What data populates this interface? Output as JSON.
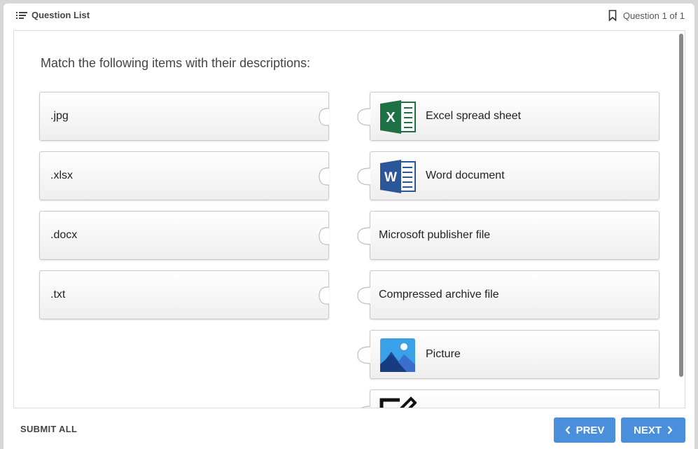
{
  "header": {
    "question_list_label": "Question List",
    "question_counter": "Question 1 of 1",
    "list_icon": "list-icon",
    "bookmark_icon": "bookmark-icon"
  },
  "question": {
    "text": "Match the following items with their descriptions:"
  },
  "left_items": [
    {
      "label": ".jpg"
    },
    {
      "label": ".xlsx"
    },
    {
      "label": ".docx"
    },
    {
      "label": ".txt"
    }
  ],
  "right_items": [
    {
      "label": "Excel spread sheet",
      "icon": "excel-icon"
    },
    {
      "label": "Word document",
      "icon": "word-icon"
    },
    {
      "label": "Microsoft publisher file",
      "icon": ""
    },
    {
      "label": "Compressed archive file",
      "icon": ""
    },
    {
      "label": "Picture",
      "icon": "picture-icon"
    },
    {
      "label": "",
      "icon": "edit-icon"
    }
  ],
  "footer": {
    "submit_label": "SUBMIT ALL",
    "prev_label": "PREV",
    "next_label": "NEXT"
  },
  "colors": {
    "accent_button": "#4a8fdc",
    "excel_green": "#1e7145",
    "word_blue": "#2b579a"
  }
}
